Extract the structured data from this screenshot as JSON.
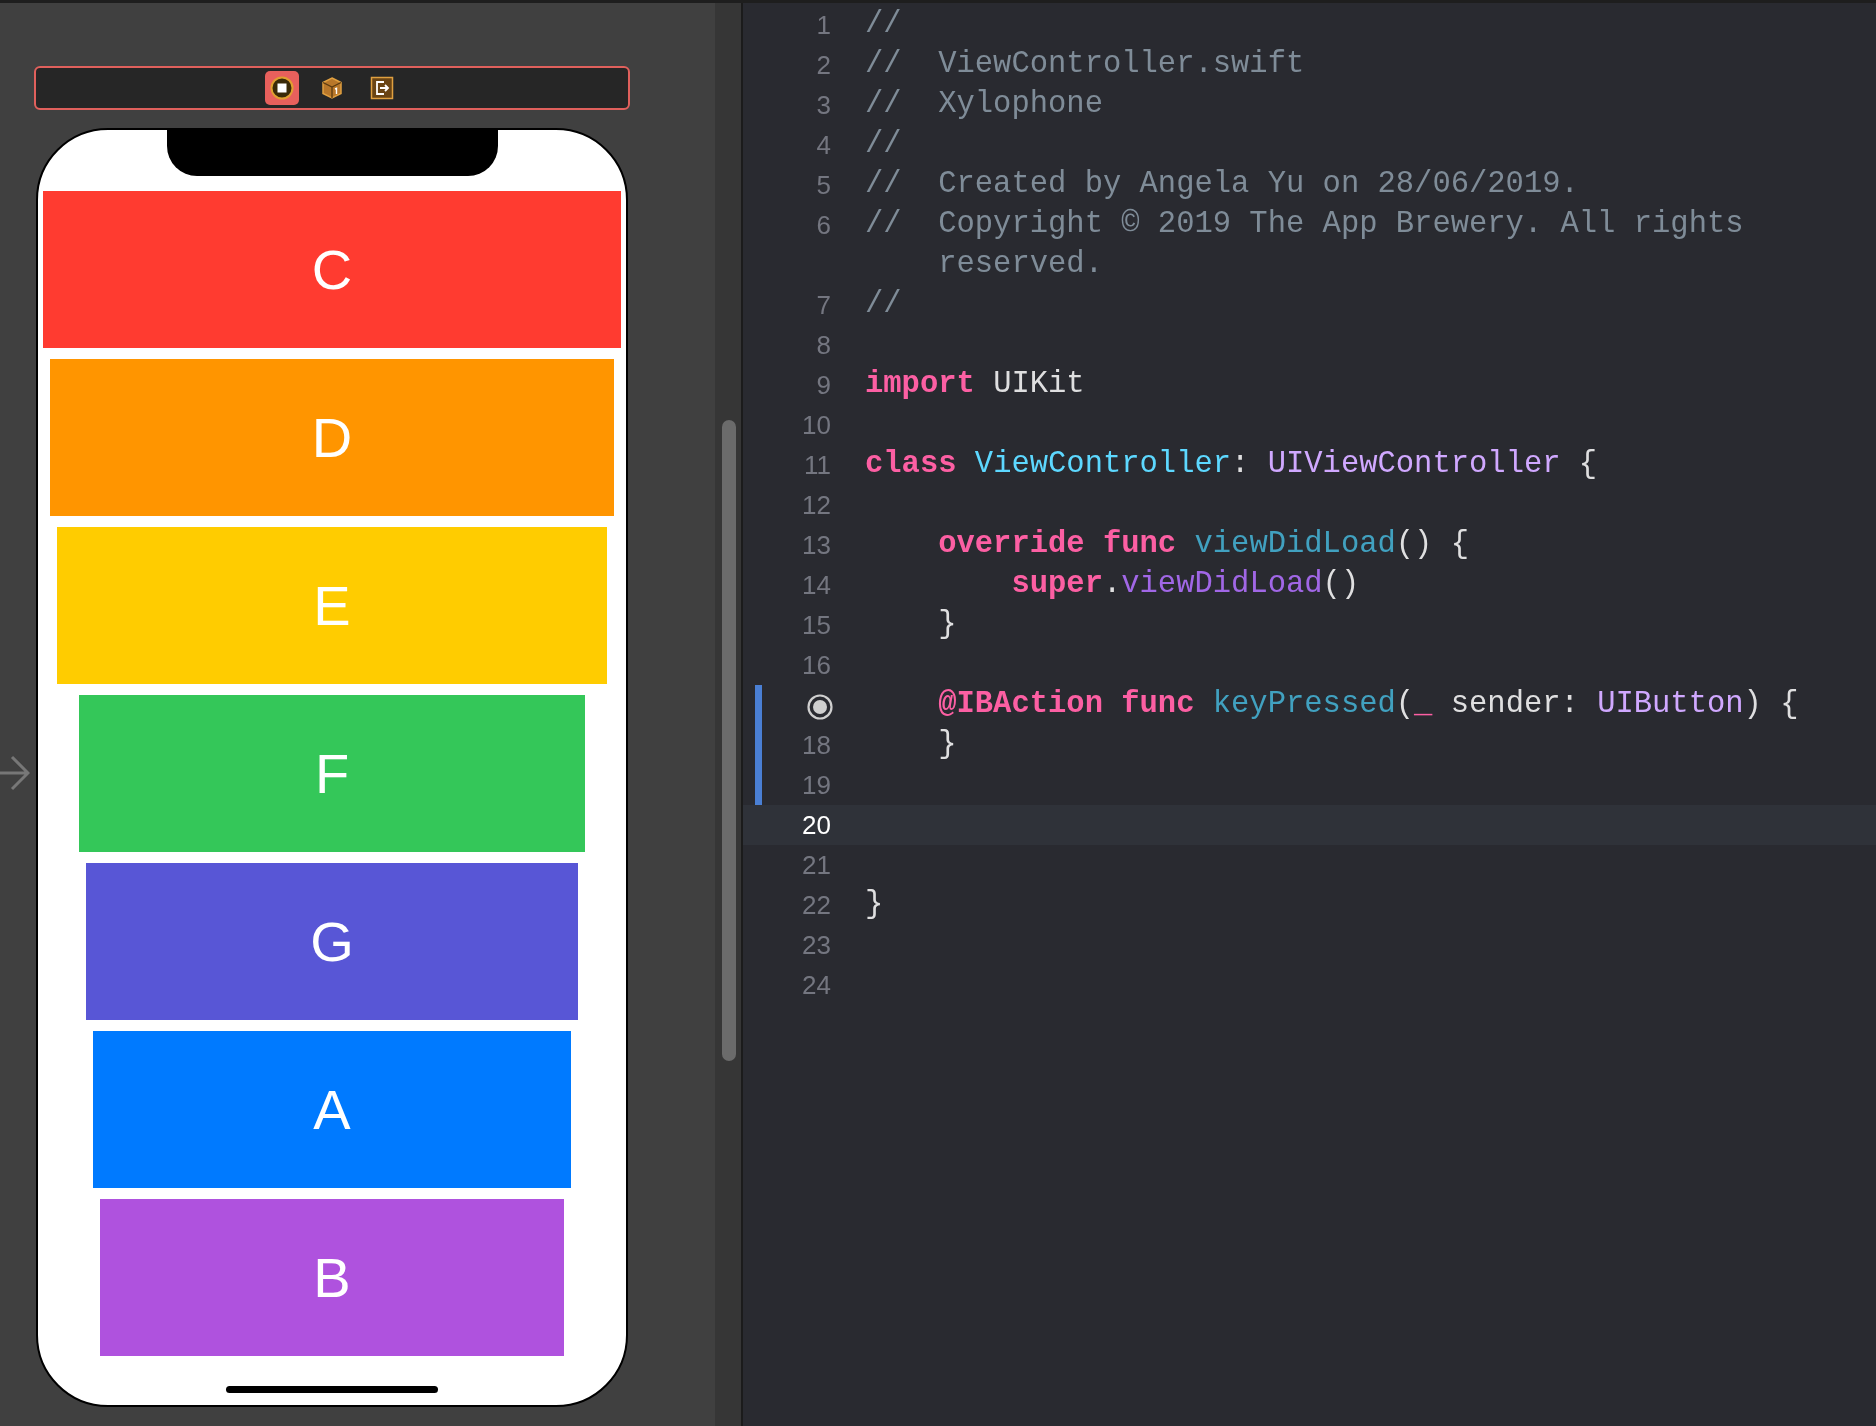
{
  "scene_dock": {
    "selected": true,
    "icons": [
      {
        "kind": "view-controller",
        "selected": true
      },
      {
        "kind": "first-responder",
        "selected": false
      },
      {
        "kind": "exit",
        "selected": false
      }
    ]
  },
  "keys": [
    {
      "label": "C",
      "color": "#ff3b30"
    },
    {
      "label": "D",
      "color": "#ff9500"
    },
    {
      "label": "E",
      "color": "#ffcc00"
    },
    {
      "label": "F",
      "color": "#34c759"
    },
    {
      "label": "G",
      "color": "#5856d6"
    },
    {
      "label": "A",
      "color": "#007aff"
    },
    {
      "label": "B",
      "color": "#af52de"
    }
  ],
  "code": {
    "lines": [
      {
        "kind": "numbered",
        "number": "1",
        "current": false,
        "changed": false,
        "tokens": [
          {
            "kind": "comment",
            "text": "//"
          }
        ]
      },
      {
        "kind": "numbered",
        "number": "2",
        "current": false,
        "changed": false,
        "tokens": [
          {
            "kind": "comment",
            "text": "//  ViewController.swift"
          }
        ]
      },
      {
        "kind": "numbered",
        "number": "3",
        "current": false,
        "changed": false,
        "tokens": [
          {
            "kind": "comment",
            "text": "//  Xylophone"
          }
        ]
      },
      {
        "kind": "numbered",
        "number": "4",
        "current": false,
        "changed": false,
        "tokens": [
          {
            "kind": "comment",
            "text": "//"
          }
        ]
      },
      {
        "kind": "numbered",
        "number": "5",
        "current": false,
        "changed": false,
        "tokens": [
          {
            "kind": "comment",
            "text": "//  Created by Angela Yu on 28/06/2019."
          }
        ]
      },
      {
        "kind": "numbered",
        "number": "6",
        "current": false,
        "changed": false,
        "tokens": [
          {
            "kind": "comment",
            "text": "//  Copyright © 2019 The App Brewery. All rights"
          }
        ],
        "continuation": "reserved."
      },
      {
        "kind": "numbered",
        "number": "7",
        "current": false,
        "changed": false,
        "tokens": [
          {
            "kind": "comment",
            "text": "//"
          }
        ]
      },
      {
        "kind": "numbered",
        "number": "8",
        "current": false,
        "changed": false
      },
      {
        "kind": "numbered",
        "number": "9",
        "current": false,
        "changed": false,
        "tokens": [
          {
            "kind": "keyword",
            "text": "import"
          },
          {
            "kind": "plain",
            "text": " UIKit"
          }
        ]
      },
      {
        "kind": "numbered",
        "number": "10",
        "current": false,
        "changed": false
      },
      {
        "kind": "numbered",
        "number": "11",
        "current": false,
        "changed": false,
        "tokens": [
          {
            "kind": "keyword",
            "text": "class "
          },
          {
            "kind": "type-decl",
            "text": "ViewController"
          },
          {
            "kind": "plain",
            "text": ": "
          },
          {
            "kind": "type",
            "text": "UIViewController"
          },
          {
            "kind": "plain",
            "text": " {"
          }
        ]
      },
      {
        "kind": "numbered",
        "number": "12",
        "current": false,
        "changed": false
      },
      {
        "kind": "numbered",
        "number": "13",
        "current": false,
        "changed": false,
        "tokens": [
          {
            "kind": "keyword",
            "text": "    override func "
          },
          {
            "kind": "func-decl",
            "text": "viewDidLoad"
          },
          {
            "kind": "plain",
            "text": "() {"
          }
        ]
      },
      {
        "kind": "numbered",
        "number": "14",
        "current": false,
        "changed": false,
        "tokens": [
          {
            "kind": "keyword",
            "text": "        super"
          },
          {
            "kind": "plain",
            "text": "."
          },
          {
            "kind": "func",
            "text": "viewDidLoad"
          },
          {
            "kind": "plain",
            "text": "()"
          }
        ]
      },
      {
        "kind": "numbered",
        "number": "15",
        "current": false,
        "changed": false,
        "tokens": [
          {
            "kind": "plain",
            "text": "    }"
          }
        ]
      },
      {
        "kind": "numbered",
        "number": "16",
        "current": false,
        "changed": false
      },
      {
        "kind": "outlet",
        "current": false,
        "changed": true,
        "tokens": [
          {
            "kind": "keyword",
            "text": "    @IBAction func "
          },
          {
            "kind": "func-decl",
            "text": "keyPressed"
          },
          {
            "kind": "plain",
            "text": "("
          },
          {
            "kind": "keyword",
            "text": "_"
          },
          {
            "kind": "plain",
            "text": " sender: "
          },
          {
            "kind": "type",
            "text": "UIButton"
          },
          {
            "kind": "plain",
            "text": ") {"
          }
        ]
      },
      {
        "kind": "numbered",
        "number": "18",
        "current": false,
        "changed": true,
        "tokens": [
          {
            "kind": "plain",
            "text": "    }"
          }
        ]
      },
      {
        "kind": "numbered",
        "number": "19",
        "current": false,
        "changed": true
      },
      {
        "kind": "numbered",
        "number": "20",
        "current": true,
        "changed": false
      },
      {
        "kind": "numbered",
        "number": "21",
        "current": false,
        "changed": false
      },
      {
        "kind": "numbered",
        "number": "22",
        "current": false,
        "changed": false,
        "tokens": [
          {
            "kind": "plain",
            "text": "}"
          }
        ]
      },
      {
        "kind": "numbered",
        "number": "23",
        "current": false,
        "changed": false
      },
      {
        "kind": "numbered",
        "number": "24",
        "current": false,
        "changed": false
      }
    ]
  }
}
